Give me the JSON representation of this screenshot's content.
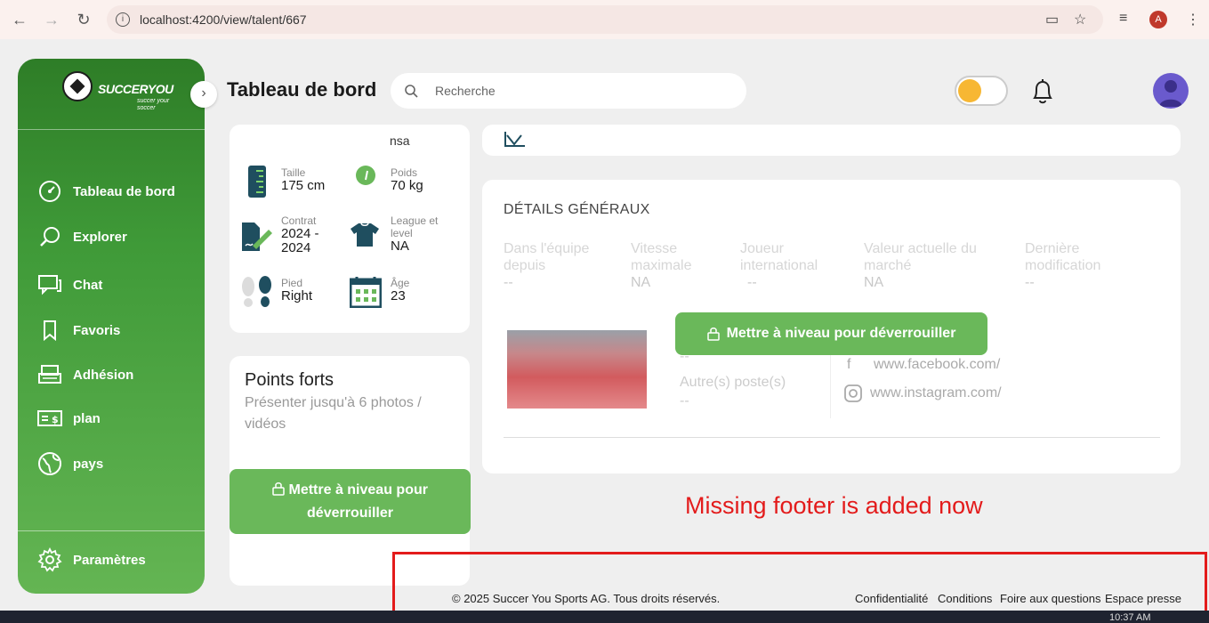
{
  "browser": {
    "url": "localhost:4200/view/talent/667",
    "profile_initial": "A"
  },
  "sidebar": {
    "logo": {
      "name": "SUCCERYOU",
      "tagline": "succer your soccer"
    },
    "items": [
      {
        "label": "Tableau de bord",
        "icon": "dashboard-gauge-icon"
      },
      {
        "label": "Explorer",
        "icon": "search-icon"
      },
      {
        "label": "Chat",
        "icon": "chat-icon"
      },
      {
        "label": "Favoris",
        "icon": "bookmark-icon"
      },
      {
        "label": "Adhésion",
        "icon": "membership-icon"
      },
      {
        "label": "plan",
        "icon": "plan-money-icon"
      },
      {
        "label": "pays",
        "icon": "globe-icon"
      }
    ],
    "settings_label": "Paramètres"
  },
  "header": {
    "title": "Tableau de bord",
    "search_placeholder": "Recherche"
  },
  "profile_card": {
    "cut_text": "nsa",
    "stats": [
      {
        "label": "Taille",
        "value": "175 cm",
        "icon": "ruler-icon"
      },
      {
        "label": "Poids",
        "value": "70 kg",
        "icon": "weight-gauge-icon"
      },
      {
        "label": "Contrat",
        "value": "2024 - 2024",
        "icon": "contract-icon"
      },
      {
        "label": "League et level",
        "value": "NA",
        "icon": "jersey-icon"
      },
      {
        "label": "Pied",
        "value": "Right",
        "icon": "footprint-icon"
      },
      {
        "label": "Âge",
        "value": "23",
        "icon": "calendar-icon"
      }
    ]
  },
  "strengths_card": {
    "title": "Points forts",
    "subtitle": "Présenter jusqu'à 6 photos / vidéos",
    "upgrade_label": "Mettre à niveau pour déverrouiller"
  },
  "general_details": {
    "title": "DÉTAILS GÉNÉRAUX",
    "columns": [
      {
        "label": "Dans l'équipe depuis",
        "value": "--"
      },
      {
        "label": "Vitesse maximale",
        "value": "NA"
      },
      {
        "label": "Joueur international",
        "value": "--"
      },
      {
        "label": "Valeur actuelle du marché",
        "value": "NA"
      },
      {
        "label": "Dernière modification",
        "value": "--"
      }
    ],
    "upgrade_label": "Mettre à niveau pour déverrouiller",
    "position_value": "--",
    "other_positions_label": "Autre(s) poste(s)",
    "other_positions_value": "--",
    "socials": [
      {
        "icon": "facebook-icon",
        "url": "www.facebook.com/"
      },
      {
        "icon": "instagram-icon",
        "url": "www.instagram.com/"
      }
    ]
  },
  "annotation": {
    "text": "Missing footer is added now",
    "color": "#e31b1b"
  },
  "footer": {
    "copyright": "© 2025 Succer You Sports AG. Tous droits réservés.",
    "links": [
      "Confidentialité",
      "Conditions",
      "Foire aux questions",
      "Espace presse"
    ]
  },
  "taskbar": {
    "time": "10:37 AM"
  },
  "colors": {
    "primary_green": "#3f9a38",
    "upgrade_green": "#6ab85a",
    "background": "#efefef"
  }
}
